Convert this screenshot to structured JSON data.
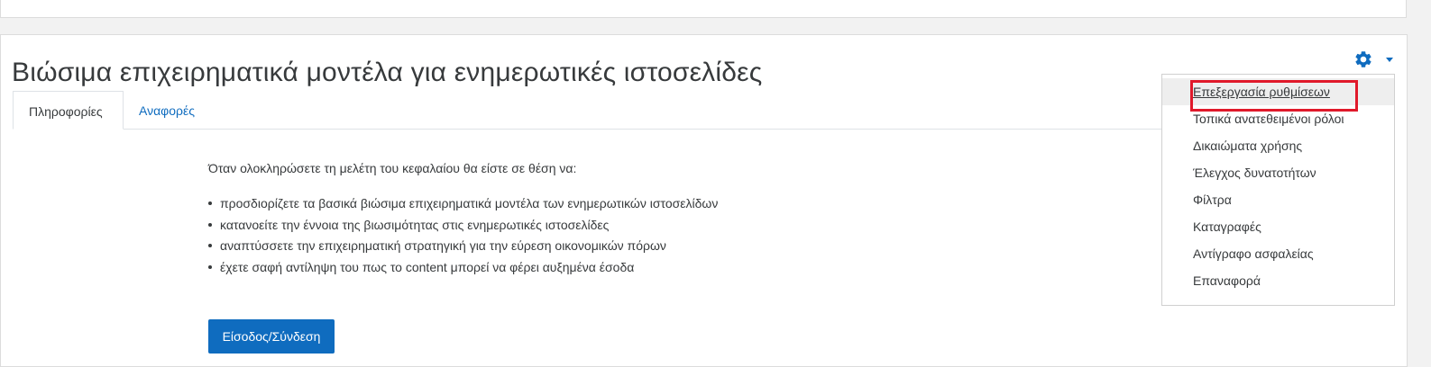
{
  "course": {
    "title": "Βιώσιμα επιχειρηματικά μοντέλα για ενημερωτικές ιστοσελίδες"
  },
  "tabs": [
    {
      "label": "Πληροφορίες",
      "active": true
    },
    {
      "label": "Αναφορές",
      "active": false
    }
  ],
  "summary": {
    "intro": "Όταν ολοκληρώσετε τη μελέτη του κεφαλαίου θα είστε σε θέση να:",
    "bullets": [
      "προσδιορίζετε τα βασικά βιώσιμα επιχειρηματικά μοντέλα των ενημερωτικών ιστοσελίδων",
      "κατανοείτε την έννοια της βιωσιμότητας στις ενημερωτικές ιστοσελίδες",
      "αναπτύσσετε την επιχειρηματική στρατηγική για την εύρεση οικονομικών πόρων",
      "έχετε σαφή αντίληψη του πως το content μπορεί να φέρει αυξημένα έσοδα"
    ]
  },
  "login_button": "Είσοδος/Σύνδεση",
  "settings_menu": {
    "icon": "gear-icon",
    "items": [
      "Επεξεργασία ρυθμίσεων",
      "Τοπικά ανατεθειμένοι ρόλοι",
      "Δικαιώματα χρήσης",
      "Έλεγχος δυνατοτήτων",
      "Φίλτρα",
      "Καταγραφές",
      "Αντίγραφο ασφαλείας",
      "Επαναφορά"
    ],
    "highlighted_item_index": 0
  },
  "colors": {
    "accent": "#0f6cbf",
    "highlight_box": "#e0192a",
    "text": "#373a3c"
  }
}
